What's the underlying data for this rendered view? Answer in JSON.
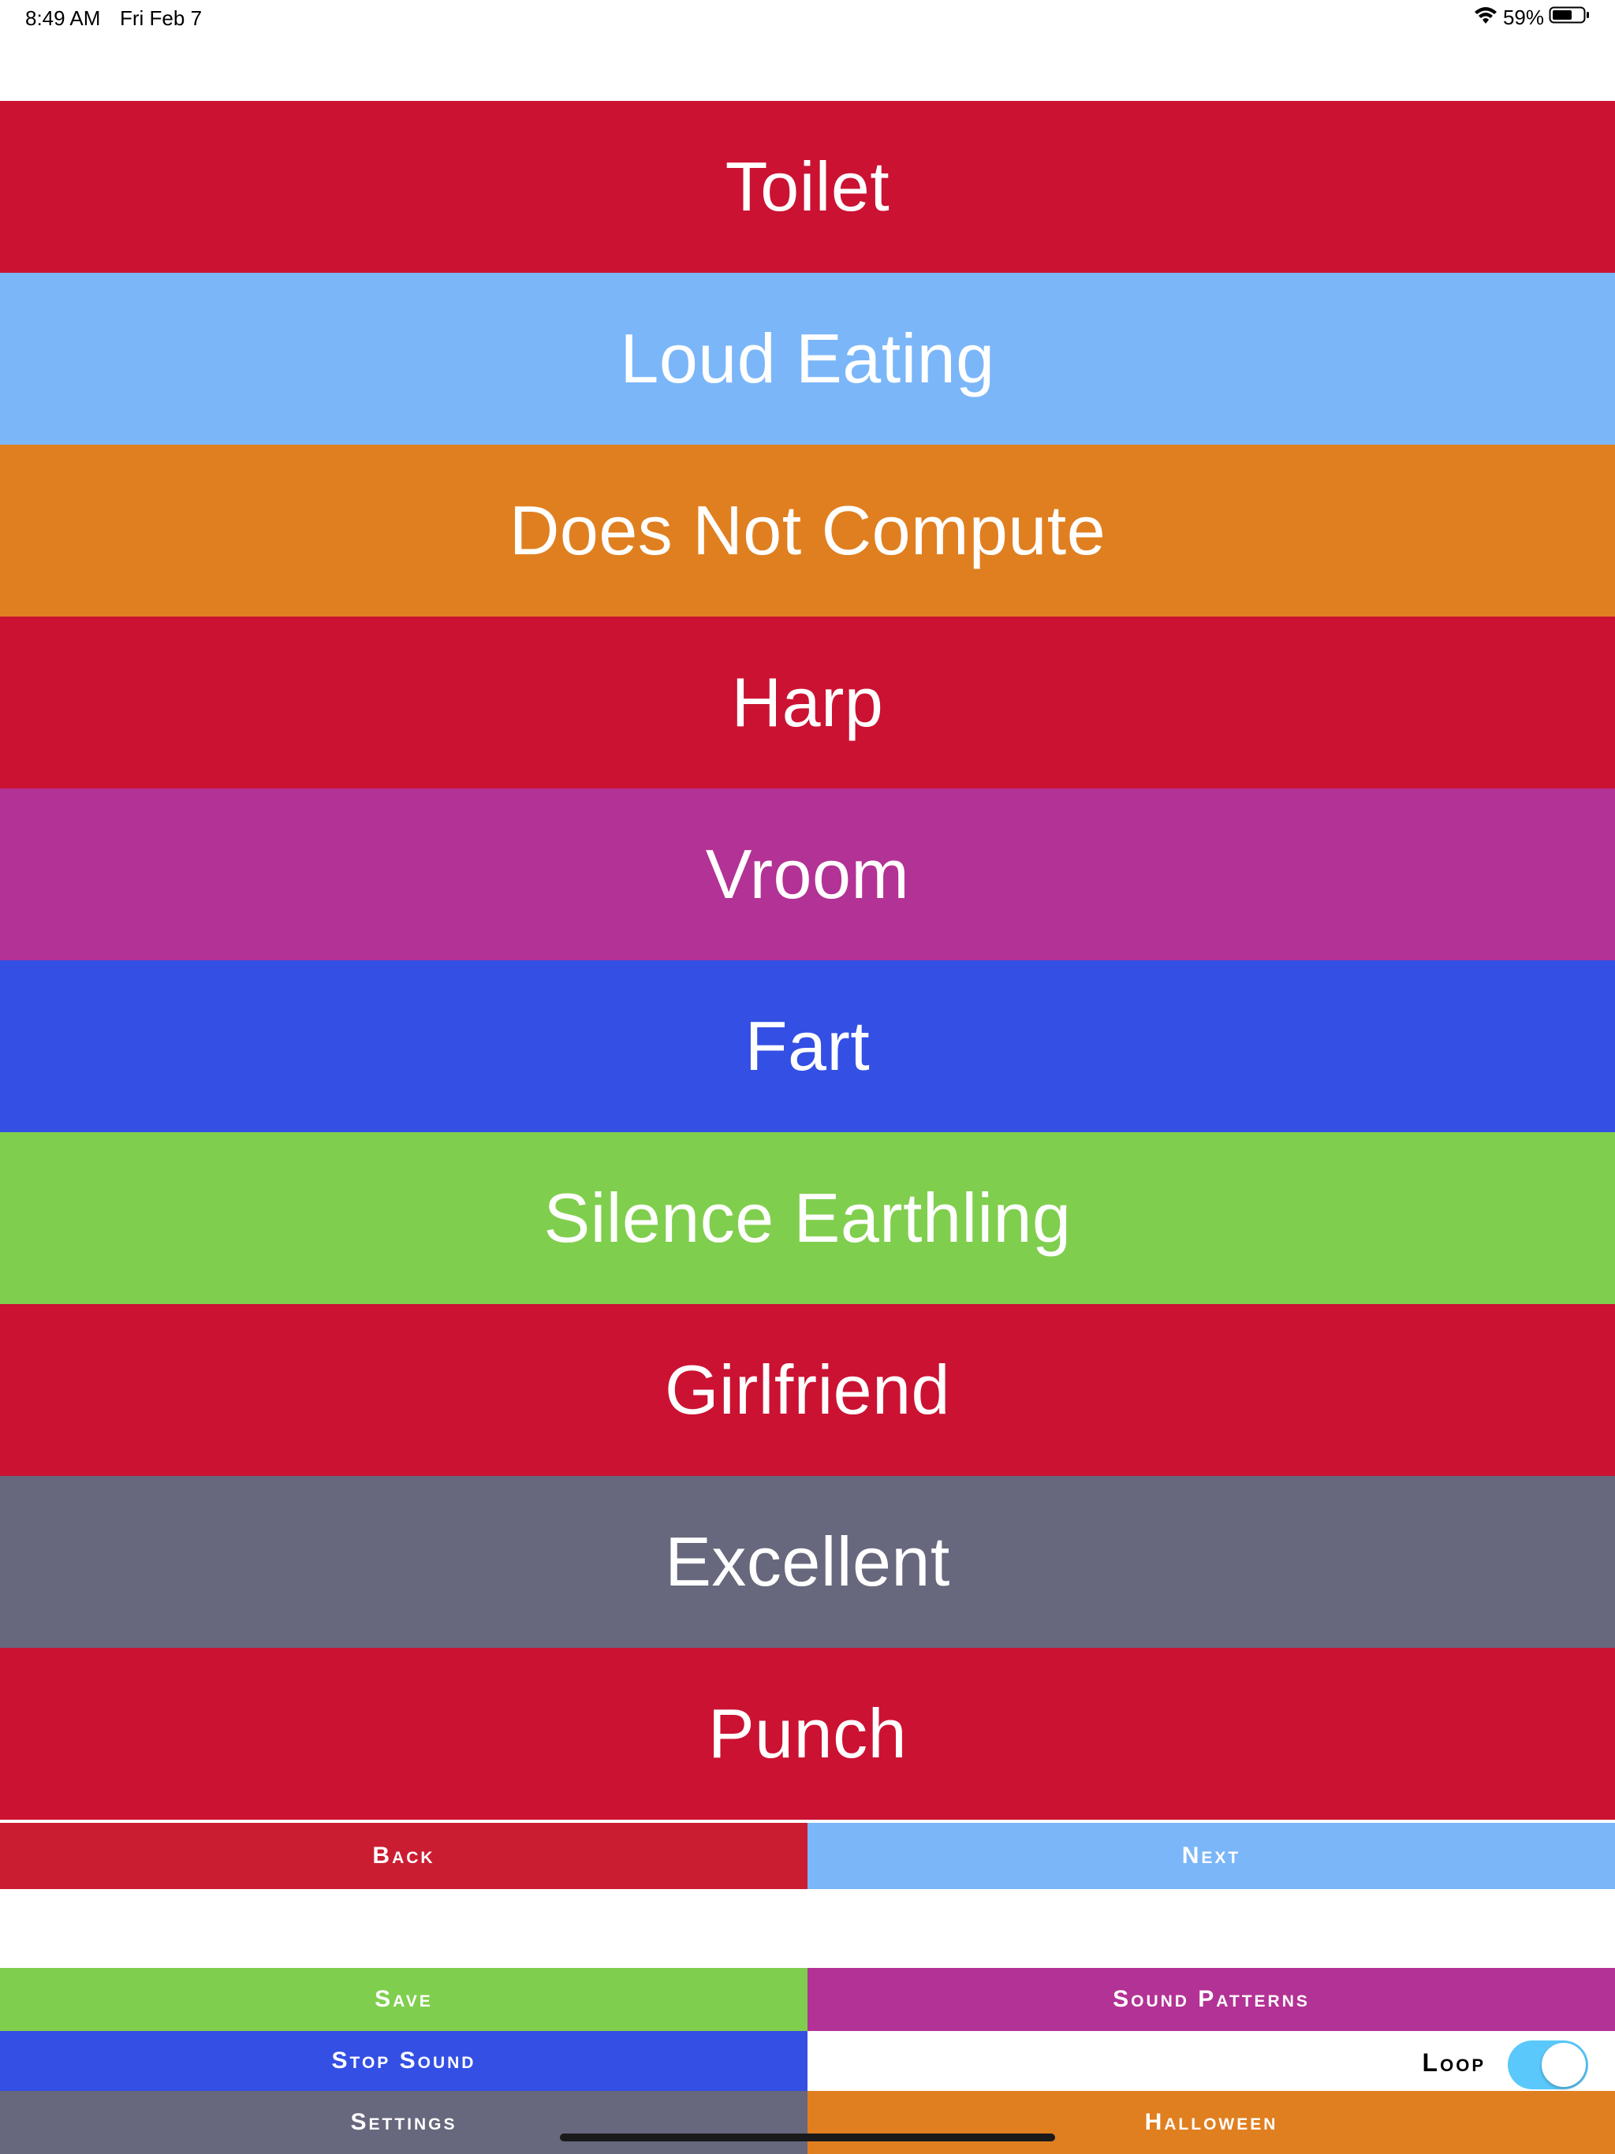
{
  "status_bar": {
    "time": "8:49 AM",
    "date": "Fri Feb 7",
    "battery": "59%"
  },
  "sounds": [
    {
      "label": "Toilet",
      "color": "#cb1232"
    },
    {
      "label": "Loud Eating",
      "color": "#7bb6f8"
    },
    {
      "label": "Does Not Compute",
      "color": "#e07f20"
    },
    {
      "label": "Harp",
      "color": "#cb1232"
    },
    {
      "label": "Vroom",
      "color": "#b33295"
    },
    {
      "label": "Fart",
      "color": "#344fe4"
    },
    {
      "label": "Silence Earthling",
      "color": "#80ce4e"
    },
    {
      "label": "Girlfriend",
      "color": "#cb1232"
    },
    {
      "label": "Excellent",
      "color": "#67677d"
    },
    {
      "label": "Punch",
      "color": "#cb1232"
    }
  ],
  "nav": {
    "back": {
      "label": "Back",
      "color": "#cb1d32"
    },
    "next": {
      "label": "Next",
      "color": "#7bb6f8"
    }
  },
  "controls": {
    "save": {
      "label": "Save",
      "color": "#80ce4e"
    },
    "sound_patterns": {
      "label": "Sound Patterns",
      "color": "#b33295"
    },
    "stop_sound": {
      "label": "Stop Sound",
      "color": "#344fe4"
    },
    "loop": {
      "label": "Loop",
      "enabled": true,
      "color": "#5ac8fa"
    },
    "settings": {
      "label": "Settings",
      "color": "#67677d"
    },
    "halloween": {
      "label": "Halloween",
      "color": "#e07f20"
    }
  }
}
